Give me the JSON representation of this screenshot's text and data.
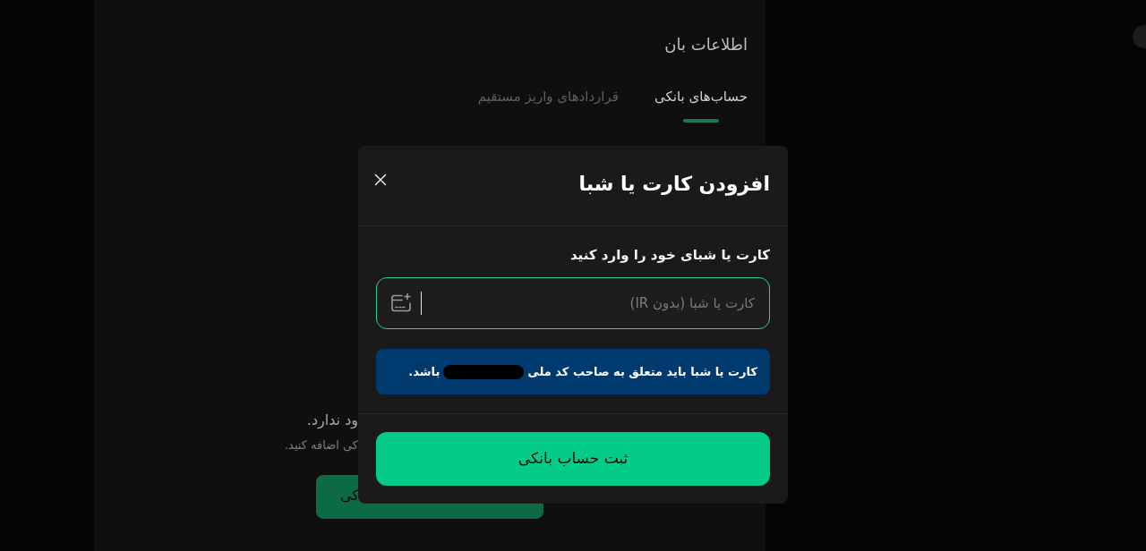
{
  "page": {
    "heading": "اطلاعات بان",
    "tabs": [
      {
        "label": "حساب‌های بانکی",
        "selected": true
      },
      {
        "label": "قراردادهای واریز مستقیم",
        "selected": false
      }
    ],
    "empty_state": {
      "message": "ود ندارد.",
      "hint": "کی اضافه کنید.",
      "button": "کی"
    }
  },
  "dialog": {
    "title": "افزودن کارت یا شبا",
    "field_label": "کارت یا شبای خود را وارد کنید",
    "card_field": {
      "placeholder": "کارت یا شبا (بدون IR)"
    },
    "notice": {
      "text_before": "کارت یا شبا باید متعلق به صاحب کد ملی",
      "text_after": "باشد."
    },
    "submit_button": "ثبت حساب بانکی"
  }
}
